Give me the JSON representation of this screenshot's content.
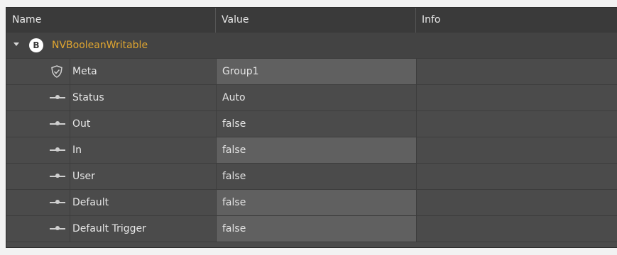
{
  "header": {
    "name": "Name",
    "value": "Value",
    "info": "Info"
  },
  "root": {
    "badge": "B",
    "label": "NVBooleanWritable",
    "accent": "#e0a630"
  },
  "rows": [
    {
      "icon": "shield-check-icon",
      "label": "Meta",
      "value": "Group1",
      "editable": true
    },
    {
      "icon": "slot-icon",
      "label": "Status",
      "value": "Auto",
      "editable": false
    },
    {
      "icon": "slot-icon",
      "label": "Out",
      "value": "false",
      "editable": false
    },
    {
      "icon": "slot-icon",
      "label": "In",
      "value": "false",
      "editable": true
    },
    {
      "icon": "slot-icon",
      "label": "User",
      "value": "false",
      "editable": false
    },
    {
      "icon": "slot-icon",
      "label": "Default",
      "value": "false",
      "editable": true
    },
    {
      "icon": "slot-icon",
      "label": "Default Trigger",
      "value": "false",
      "editable": true
    }
  ]
}
